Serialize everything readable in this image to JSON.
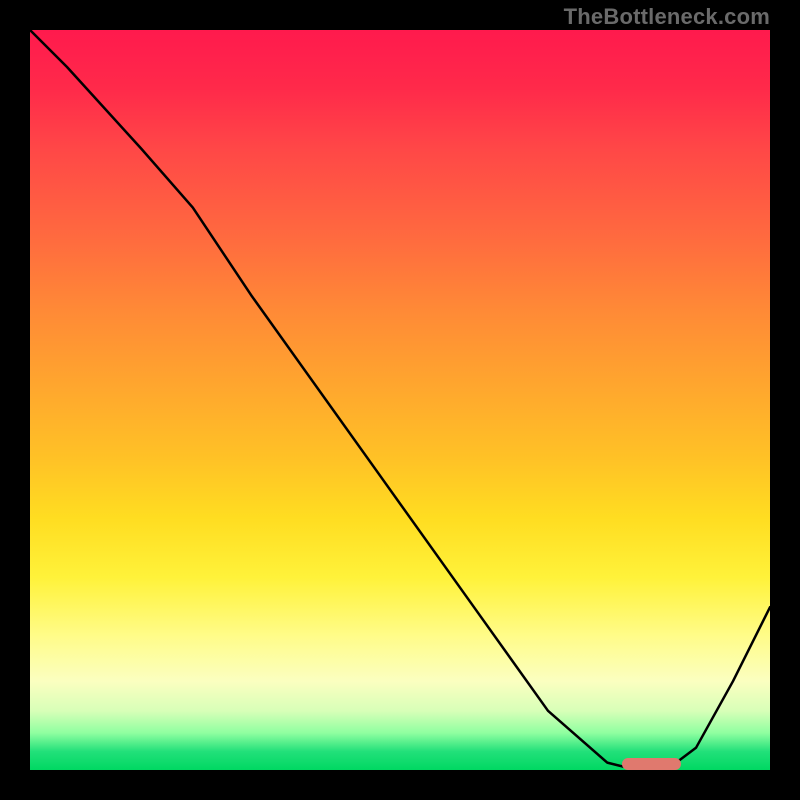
{
  "watermark": "TheBottleneck.com",
  "chart_data": {
    "type": "line",
    "title": "",
    "xlabel": "",
    "ylabel": "",
    "xlim": [
      0,
      100
    ],
    "ylim": [
      0,
      100
    ],
    "grid": false,
    "series": [
      {
        "name": "bottleneck-curve",
        "x": [
          0,
          5,
          15,
          22,
          30,
          40,
          50,
          60,
          70,
          78,
          82,
          86,
          90,
          95,
          100
        ],
        "y": [
          100,
          95,
          84,
          76,
          64,
          50,
          36,
          22,
          8,
          1,
          0,
          0,
          3,
          12,
          22
        ]
      }
    ],
    "marker": {
      "name": "optimal-range",
      "x_start": 80,
      "x_end": 88,
      "y": 0.8,
      "color": "#e0796e"
    },
    "background_gradient": {
      "top": "#ff1a4d",
      "mid": "#ffdd21",
      "bottom": "#00d862"
    }
  }
}
